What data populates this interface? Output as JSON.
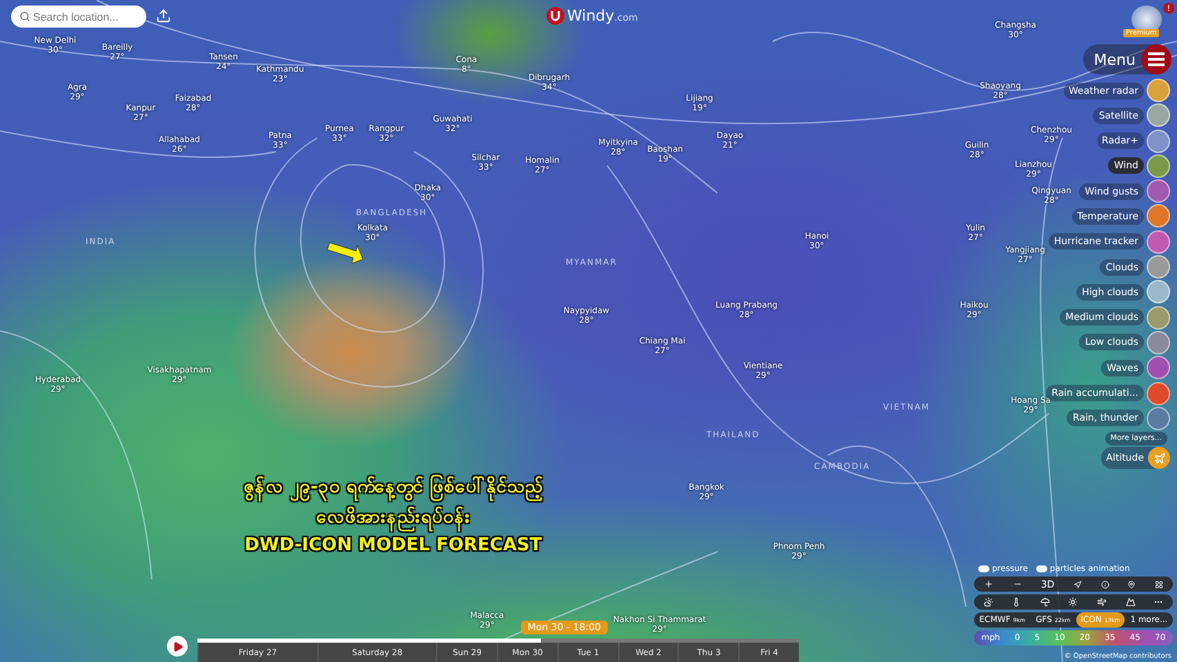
{
  "search": {
    "placeholder": "Search location..."
  },
  "logo": {
    "name": "Windy",
    "suffix": ".com"
  },
  "account": {
    "badge": "!",
    "tag": "Premium"
  },
  "menu": {
    "label": "Menu"
  },
  "layers": [
    {
      "label": "Weather radar",
      "selected": false,
      "color": "#d9a23a"
    },
    {
      "label": "Satellite",
      "selected": false,
      "color": "#9aa7a0"
    },
    {
      "label": "Radar+",
      "selected": false,
      "color": "#7f93c8"
    },
    {
      "label": "Wind",
      "selected": true,
      "color": "#7a9a4a"
    },
    {
      "label": "Wind gusts",
      "selected": false,
      "color": "#a05ab0"
    },
    {
      "label": "Temperature",
      "selected": false,
      "color": "#e0762a"
    },
    {
      "label": "Hurricane tracker",
      "selected": false,
      "color": "#c05ab0"
    },
    {
      "label": "Clouds",
      "selected": false,
      "color": "#9a9a9a"
    },
    {
      "label": "High clouds",
      "selected": false,
      "color": "#9ab8c8"
    },
    {
      "label": "Medium clouds",
      "selected": false,
      "color": "#9a9a6a"
    },
    {
      "label": "Low clouds",
      "selected": false,
      "color": "#8a8a9a"
    },
    {
      "label": "Waves",
      "selected": false,
      "color": "#a050b0"
    },
    {
      "label": "Rain accumulati...",
      "selected": false,
      "color": "#e04a2a"
    },
    {
      "label": "Rain, thunder",
      "selected": false,
      "color": "#5a7aa0"
    }
  ],
  "more_layers": "More layers...",
  "altitude": "Altitude",
  "regions": [
    {
      "name": "INDIA"
    },
    {
      "name": "BANGLADESH"
    },
    {
      "name": "MYANMAR"
    },
    {
      "name": "THAILAND"
    },
    {
      "name": "CAMBODIA"
    },
    {
      "name": "VIETNAM"
    }
  ],
  "cities": [
    {
      "name": "New Delhi",
      "temp": "30°"
    },
    {
      "name": "Bareilly",
      "temp": "27°"
    },
    {
      "name": "Agra",
      "temp": "29°"
    },
    {
      "name": "Kanpur",
      "temp": "27°"
    },
    {
      "name": "Faizabad",
      "temp": "28°"
    },
    {
      "name": "Tansen",
      "temp": "24°"
    },
    {
      "name": "Kathmandu",
      "temp": "23°"
    },
    {
      "name": "Allahabad",
      "temp": "26°"
    },
    {
      "name": "Patna",
      "temp": "33°"
    },
    {
      "name": "Purnea",
      "temp": "33°"
    },
    {
      "name": "Rangpur",
      "temp": "32°"
    },
    {
      "name": "Cona",
      "temp": "8°"
    },
    {
      "name": "Dibrugarh",
      "temp": "34°"
    },
    {
      "name": "Guwahati",
      "temp": "32°"
    },
    {
      "name": "Silchar",
      "temp": "33°"
    },
    {
      "name": "Homalin",
      "temp": "27°"
    },
    {
      "name": "Myitkyina",
      "temp": "28°"
    },
    {
      "name": "Baoshan",
      "temp": "19°"
    },
    {
      "name": "Lijiang",
      "temp": "19°"
    },
    {
      "name": "Dayao",
      "temp": "21°"
    },
    {
      "name": "Dhaka",
      "temp": "30°"
    },
    {
      "name": "Kolkata",
      "temp": "30°"
    },
    {
      "name": "Naypyidaw",
      "temp": "28°"
    },
    {
      "name": "Chiang Mai",
      "temp": "27°"
    },
    {
      "name": "Luang Prabang",
      "temp": "28°"
    },
    {
      "name": "Hanoi",
      "temp": "30°"
    },
    {
      "name": "Vientiane",
      "temp": "29°"
    },
    {
      "name": "Bangkok",
      "temp": "29°"
    },
    {
      "name": "Phnom Penh",
      "temp": "29°"
    },
    {
      "name": "Visakhapatnam",
      "temp": "29°"
    },
    {
      "name": "Hyderabad",
      "temp": "29°"
    },
    {
      "name": "Changsha",
      "temp": "30°"
    },
    {
      "name": "Shaoyang",
      "temp": "28°"
    },
    {
      "name": "Chenzhou",
      "temp": "29°"
    },
    {
      "name": "Guilin",
      "temp": "28°"
    },
    {
      "name": "Lianzhou",
      "temp": "29°"
    },
    {
      "name": "Qingyuan",
      "temp": "28°"
    },
    {
      "name": "Yulin",
      "temp": "27°"
    },
    {
      "name": "Yangjiang",
      "temp": "27°"
    },
    {
      "name": "Haikou",
      "temp": "29°"
    },
    {
      "name": "Hoang Sa",
      "temp": "29°"
    },
    {
      "name": "Malacca",
      "temp": "29°"
    },
    {
      "name": "Nakhon Si Thammarat",
      "temp": "29°"
    }
  ],
  "caption": {
    "line_1": "ဇွန်လ ၂၉-၃၀ ရက်နေ့တွင် ဖြစ်ပေါ်နိုင်သည့်",
    "line_2": "လေဖိအားနည်းရပ်ဝန်း",
    "line_3": "DWD-ICON MODEL FORECAST"
  },
  "toggles": [
    {
      "label": "pressure",
      "on": true
    },
    {
      "label": "particles animation",
      "on": true
    }
  ],
  "view_3d": "3D",
  "models": [
    {
      "label": "ECMWF",
      "sub": "9km",
      "selected": false
    },
    {
      "label": "GFS",
      "sub": "22km",
      "selected": false
    },
    {
      "label": "ICON",
      "sub": "13km",
      "selected": true
    },
    {
      "label": "1 more...",
      "selected": false
    }
  ],
  "legend": {
    "unit": "mph",
    "stops": [
      "0",
      "5",
      "10",
      "20",
      "35",
      "45",
      "70"
    ]
  },
  "attribution": "© OpenStreetMap contributors",
  "timeline": {
    "current": "Mon 30 - 18:00",
    "level": 0.57,
    "days": [
      {
        "label": "Friday 27"
      },
      {
        "label": "Saturday 28"
      },
      {
        "label": "Sun 29"
      },
      {
        "label": "Mon 30"
      },
      {
        "label": "Tue 1"
      },
      {
        "label": "Wed 2"
      },
      {
        "label": "Thu 3"
      },
      {
        "label": "Fri 4"
      }
    ]
  }
}
